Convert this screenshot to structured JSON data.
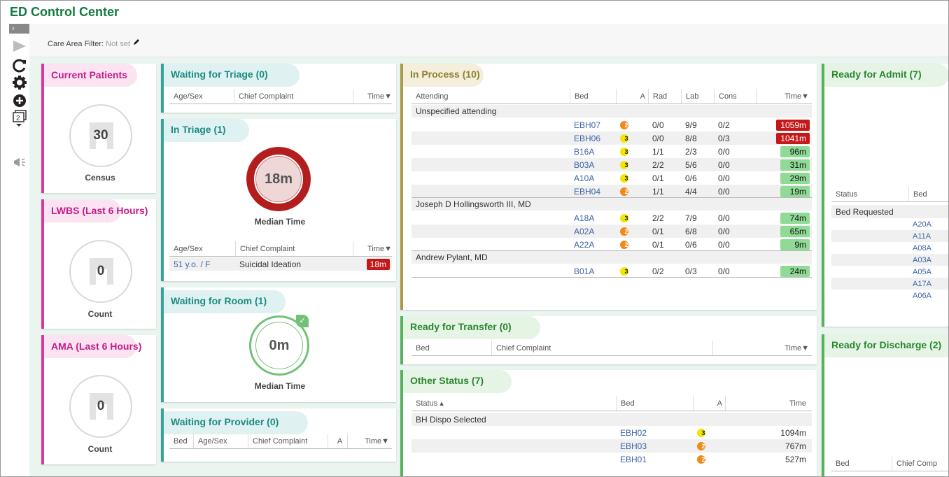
{
  "app": {
    "title": "ED Control Center"
  },
  "sidebar": {
    "toggle_glyph": "›"
  },
  "filter": {
    "label": "Care Area Filter:",
    "value": "Not set"
  },
  "current_patients": {
    "title": "Current Patients",
    "value": "30",
    "label": "Census"
  },
  "lwbs": {
    "title": "LWBS (Last 6 Hours)",
    "value": "0",
    "label": "Count"
  },
  "ama": {
    "title": "AMA (Last 6 Hours)",
    "value": "0",
    "label": "Count"
  },
  "waiting_triage": {
    "title": "Waiting for Triage (0)",
    "headers": [
      "Age/Sex",
      "Chief Complaint",
      "Time▼"
    ]
  },
  "in_triage": {
    "title": "In Triage (1)",
    "gauge_value": "18m",
    "gauge_flag": "!!",
    "gauge_label": "Median Time",
    "headers": [
      "Age/Sex",
      "Chief Complaint",
      "Time▼"
    ],
    "rows": [
      {
        "age_sex": "51 y.o. / F",
        "complaint": "Suicidal Ideation",
        "time": "18m"
      }
    ]
  },
  "waiting_room": {
    "title": "Waiting for Room (1)",
    "gauge_value": "0m",
    "gauge_flag": "✓",
    "gauge_label": "Median Time"
  },
  "waiting_provider": {
    "title": "Waiting for Provider (0)",
    "headers": [
      "Bed",
      "Age/Sex",
      "Chief Complaint",
      "A",
      "Time▼"
    ]
  },
  "in_process": {
    "title": "In Process (10)",
    "headers": [
      "Attending",
      "Bed",
      "A",
      "Rad",
      "Lab",
      "Cons",
      "Time▼"
    ],
    "groups": [
      {
        "name": "Unspecified attending",
        "rows": [
          {
            "bed": "EBH07",
            "a": "2",
            "rad": "0/0",
            "lab": "9/9",
            "cons": "0/2",
            "time": "1059m",
            "status": "red"
          },
          {
            "bed": "EBH06",
            "a": "3",
            "rad": "0/0",
            "lab": "8/8",
            "cons": "0/3",
            "time": "1041m",
            "status": "red"
          },
          {
            "bed": "B16A",
            "a": "3",
            "rad": "1/1",
            "lab": "2/3",
            "cons": "0/0",
            "time": "96m",
            "status": "green"
          },
          {
            "bed": "B03A",
            "a": "3",
            "rad": "2/2",
            "lab": "5/6",
            "cons": "0/0",
            "time": "31m",
            "status": "green"
          },
          {
            "bed": "A10A",
            "a": "3",
            "rad": "0/1",
            "lab": "0/6",
            "cons": "0/0",
            "time": "29m",
            "status": "green"
          },
          {
            "bed": "EBH04",
            "a": "2",
            "rad": "1/1",
            "lab": "4/4",
            "cons": "0/0",
            "time": "19m",
            "status": "green"
          }
        ]
      },
      {
        "name": "Joseph D Hollingsworth III, MD",
        "rows": [
          {
            "bed": "A18A",
            "a": "3",
            "rad": "2/2",
            "lab": "7/9",
            "cons": "0/0",
            "time": "74m",
            "status": "green"
          },
          {
            "bed": "A02A",
            "a": "2",
            "rad": "0/1",
            "lab": "6/8",
            "cons": "0/0",
            "time": "65m",
            "status": "green"
          },
          {
            "bed": "A22A",
            "a": "2",
            "rad": "0/1",
            "lab": "0/6",
            "cons": "0/0",
            "time": "9m",
            "status": "green"
          }
        ]
      },
      {
        "name": "Andrew Pylant, MD",
        "rows": [
          {
            "bed": "B01A",
            "a": "3",
            "rad": "0/2",
            "lab": "0/3",
            "cons": "0/0",
            "time": "24m",
            "status": "green"
          }
        ]
      }
    ]
  },
  "ready_transfer": {
    "title": "Ready for Transfer (0)",
    "headers": [
      "Bed",
      "Chief Complaint",
      "Time▼"
    ]
  },
  "other_status": {
    "title": "Other Status (7)",
    "headers": [
      "Status ▴",
      "Bed",
      "A",
      "Time"
    ],
    "groups": [
      {
        "name": "BH Dispo Selected",
        "rows": [
          {
            "bed": "EBH02",
            "a": "3",
            "time": "1094m"
          },
          {
            "bed": "EBH03",
            "a": "2",
            "time": "767m"
          },
          {
            "bed": "EBH01",
            "a": "2",
            "time": "527m"
          }
        ]
      }
    ]
  },
  "ready_admit": {
    "title": "Ready for Admit (7)",
    "headers": [
      "Status",
      "Bed"
    ],
    "group": "Bed Requested",
    "beds": [
      "A20A",
      "A11A",
      "A08A",
      "A03A",
      "A05A",
      "A17A",
      "A06A"
    ]
  },
  "ready_discharge": {
    "title": "Ready for Discharge (2)",
    "headers": [
      "Bed",
      "Chief Comp"
    ]
  },
  "colors": {
    "red": "#c51818",
    "green": "#8fdb95",
    "pink": "#d63a9c",
    "teal": "#37a39a",
    "olive": "#a99a48",
    "admit": "#56b25c"
  }
}
